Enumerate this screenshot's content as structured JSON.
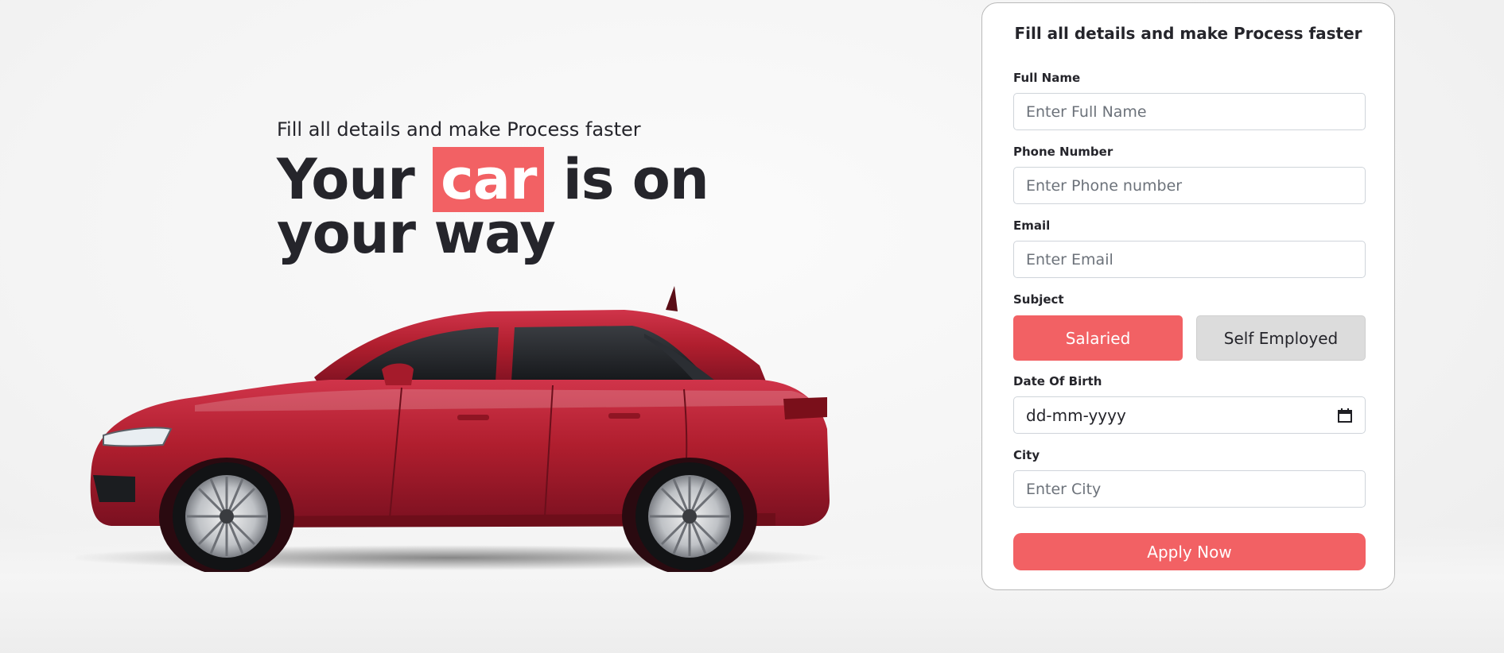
{
  "hero": {
    "subtitle": "Fill all details and make Process faster",
    "title_before": "Your ",
    "title_highlight": "car",
    "title_after": " is on",
    "title_line2": "your way"
  },
  "form": {
    "title": "Fill all details and make Process faster",
    "full_name": {
      "label": "Full Name",
      "placeholder": "Enter Full Name"
    },
    "phone": {
      "label": "Phone Number",
      "placeholder": "Enter Phone number"
    },
    "email": {
      "label": "Email",
      "placeholder": "Enter Email"
    },
    "subject": {
      "label": "Subject",
      "options": [
        "Salaried",
        "Self Employed"
      ],
      "selected": "Salaried"
    },
    "dob": {
      "label": "Date Of Birth",
      "value": "dd-mm-yyyy"
    },
    "city": {
      "label": "City",
      "placeholder": "Enter City"
    },
    "submit_label": "Apply Now"
  },
  "colors": {
    "accent": "#f26164",
    "text": "#25252b",
    "car_body": "#b01e2e"
  },
  "icons": {
    "date_picker": "calendar-icon",
    "illustration": "red-car-illustration"
  }
}
